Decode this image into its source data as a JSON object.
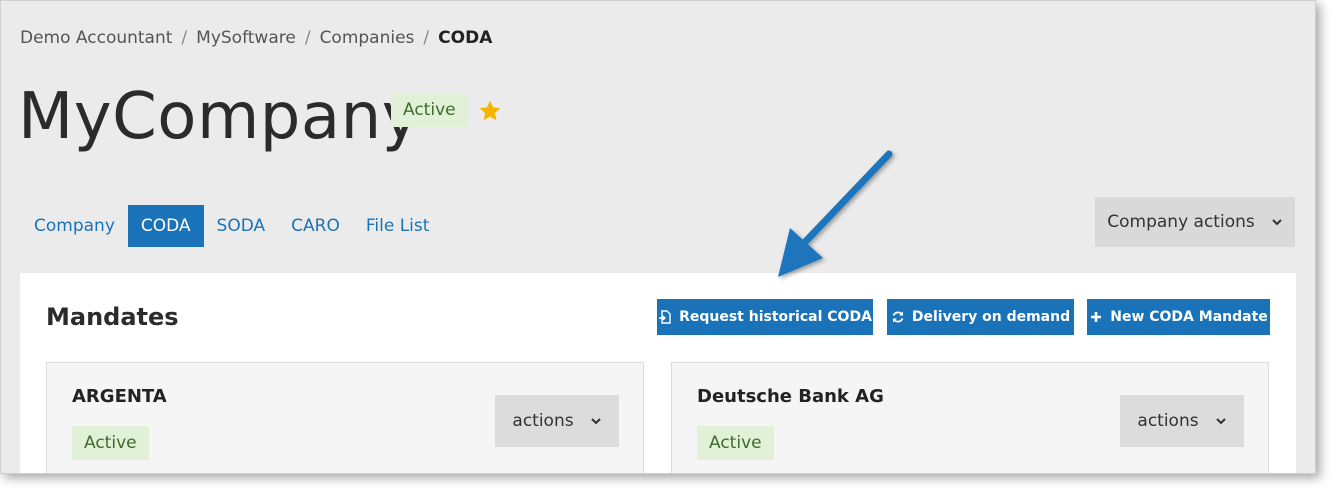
{
  "breadcrumb": {
    "items": [
      "Demo Accountant",
      "MySoftware",
      "Companies"
    ],
    "current": "CODA",
    "separator": "/"
  },
  "page": {
    "title": "MyCompany",
    "status": "Active",
    "favorite_icon": "star-icon",
    "star_color": "#f5b400"
  },
  "tabs": [
    {
      "label": "Company",
      "active": false
    },
    {
      "label": "CODA",
      "active": true
    },
    {
      "label": "SODA",
      "active": false
    },
    {
      "label": "CARO",
      "active": false
    },
    {
      "label": "File List",
      "active": false
    }
  ],
  "company_actions": {
    "label": "Company actions",
    "icon": "chevron-down-icon"
  },
  "mandates": {
    "title": "Mandates",
    "buttons": {
      "request_historical": {
        "label": "Request historical CODA",
        "icon": "file-import-icon"
      },
      "delivery_on_demand": {
        "label": "Delivery on demand",
        "icon": "refresh-icon"
      },
      "new_mandate": {
        "label": "New CODA Mandate",
        "icon": "plus-icon"
      }
    },
    "cards": [
      {
        "bank": "ARGENTA",
        "status": "Active",
        "actions_label": "actions"
      },
      {
        "bank": "Deutsche Bank AG",
        "status": "Active",
        "actions_label": "actions"
      }
    ]
  },
  "colors": {
    "accent": "#1a73b8",
    "badge_bg": "#e1f1d8",
    "badge_text": "#3f6b2a",
    "annotation_arrow": "#1f74bd"
  }
}
